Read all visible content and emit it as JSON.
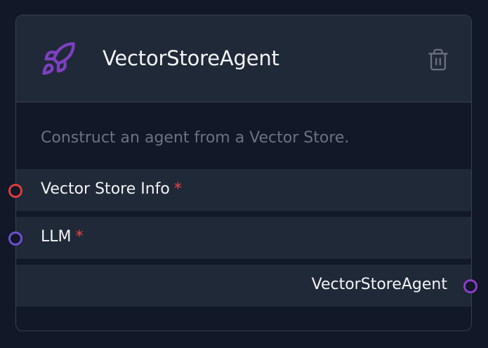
{
  "node": {
    "title": "VectorStoreAgent",
    "icon": "rocket-icon",
    "accent": "#7e3fc0",
    "description": "Construct an agent from a Vector Store.",
    "inputs": [
      {
        "label": "Vector Store Info",
        "required": "*",
        "handle_color": "#dc3c3c"
      },
      {
        "label": "LLM",
        "required": "*",
        "handle_color": "#6d4fd1"
      }
    ],
    "output": {
      "label": "VectorStoreAgent",
      "handle_color": "#8e3bc9"
    }
  }
}
